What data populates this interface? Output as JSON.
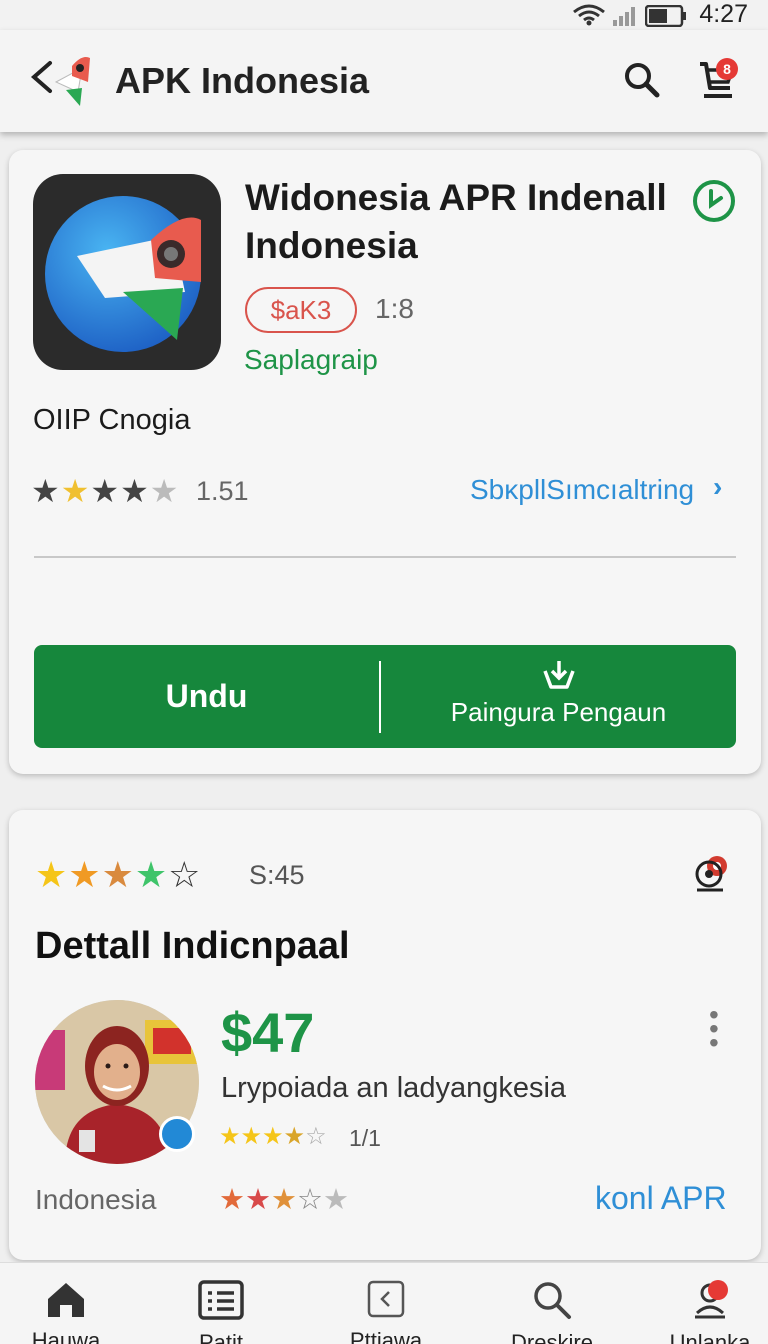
{
  "status_bar": {
    "time": "4:27"
  },
  "app_bar": {
    "title": "APK Indonesia",
    "cart_count": "8"
  },
  "app_card": {
    "title": "Widonesia APR Indenall Indonesia",
    "price": "$aK3",
    "version": "1:8",
    "category": "Saplagraip",
    "developer": "OIIP Cnogia",
    "rating_stars": 3.5,
    "rating_value": "1.51",
    "link": "SbκpllSımcıaltring",
    "primary_button": "Undu",
    "secondary_button": "Paingura Pengaun"
  },
  "detail_card": {
    "stars": 4,
    "count": "S:45",
    "title": "Dettall Indicnpaal",
    "price": "$47",
    "description": "Lrypoiada an ladyangkesia",
    "rating": "1/1",
    "country": "Indonesia",
    "link": "konl APR"
  },
  "bottom_nav": [
    {
      "label": "Hauwa",
      "icon": "home-icon"
    },
    {
      "label": "Patit",
      "icon": "list-icon"
    },
    {
      "label": "Pttiawa",
      "icon": "back-box-icon"
    },
    {
      "label": "Dreskire",
      "icon": "search-icon"
    },
    {
      "label": "Unlanka",
      "icon": "profile-icon"
    }
  ],
  "colors": {
    "green": "#16873c",
    "accent_blue": "#2f8fd6",
    "red": "#e53935"
  }
}
